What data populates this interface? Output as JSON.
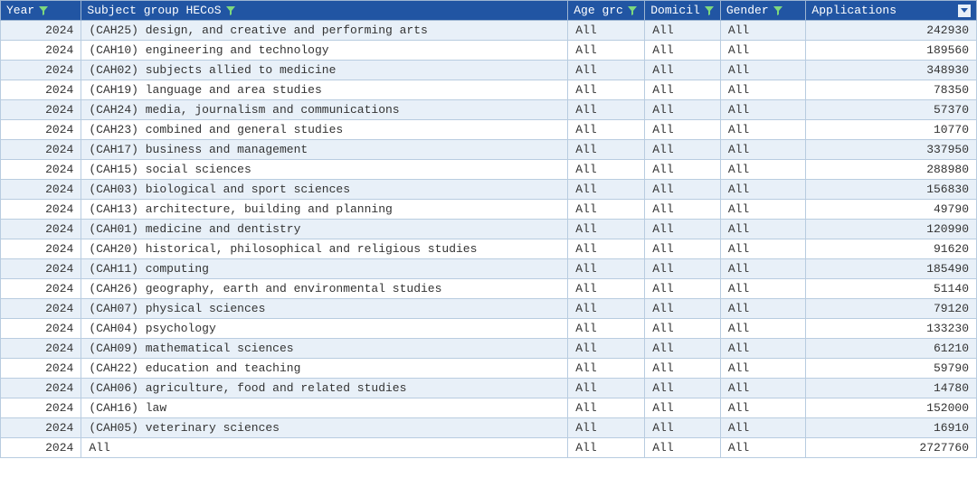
{
  "headers": {
    "year": "Year",
    "subject": "Subject group HECoS",
    "age": "Age grc",
    "domicile": "Domicil",
    "gender": "Gender",
    "applications": "Applications"
  },
  "rows": [
    {
      "year": "2024",
      "subject": "(CAH25) design, and creative and performing arts",
      "age": "All",
      "domicile": "All",
      "gender": "All",
      "applications": "242930"
    },
    {
      "year": "2024",
      "subject": "(CAH10) engineering and technology",
      "age": "All",
      "domicile": "All",
      "gender": "All",
      "applications": "189560"
    },
    {
      "year": "2024",
      "subject": "(CAH02) subjects allied to medicine",
      "age": "All",
      "domicile": "All",
      "gender": "All",
      "applications": "348930"
    },
    {
      "year": "2024",
      "subject": "(CAH19) language and area studies",
      "age": "All",
      "domicile": "All",
      "gender": "All",
      "applications": "78350"
    },
    {
      "year": "2024",
      "subject": "(CAH24) media, journalism and communications",
      "age": "All",
      "domicile": "All",
      "gender": "All",
      "applications": "57370"
    },
    {
      "year": "2024",
      "subject": "(CAH23) combined and general studies",
      "age": "All",
      "domicile": "All",
      "gender": "All",
      "applications": "10770"
    },
    {
      "year": "2024",
      "subject": "(CAH17) business and management",
      "age": "All",
      "domicile": "All",
      "gender": "All",
      "applications": "337950"
    },
    {
      "year": "2024",
      "subject": "(CAH15) social sciences",
      "age": "All",
      "domicile": "All",
      "gender": "All",
      "applications": "288980"
    },
    {
      "year": "2024",
      "subject": "(CAH03) biological and sport sciences",
      "age": "All",
      "domicile": "All",
      "gender": "All",
      "applications": "156830"
    },
    {
      "year": "2024",
      "subject": "(CAH13) architecture, building and planning",
      "age": "All",
      "domicile": "All",
      "gender": "All",
      "applications": "49790"
    },
    {
      "year": "2024",
      "subject": "(CAH01) medicine and dentistry",
      "age": "All",
      "domicile": "All",
      "gender": "All",
      "applications": "120990"
    },
    {
      "year": "2024",
      "subject": "(CAH20) historical, philosophical and religious studies",
      "age": "All",
      "domicile": "All",
      "gender": "All",
      "applications": "91620"
    },
    {
      "year": "2024",
      "subject": "(CAH11) computing",
      "age": "All",
      "domicile": "All",
      "gender": "All",
      "applications": "185490"
    },
    {
      "year": "2024",
      "subject": "(CAH26) geography, earth and environmental studies",
      "age": "All",
      "domicile": "All",
      "gender": "All",
      "applications": "51140"
    },
    {
      "year": "2024",
      "subject": "(CAH07) physical sciences",
      "age": "All",
      "domicile": "All",
      "gender": "All",
      "applications": "79120"
    },
    {
      "year": "2024",
      "subject": "(CAH04) psychology",
      "age": "All",
      "domicile": "All",
      "gender": "All",
      "applications": "133230"
    },
    {
      "year": "2024",
      "subject": "(CAH09) mathematical sciences",
      "age": "All",
      "domicile": "All",
      "gender": "All",
      "applications": "61210"
    },
    {
      "year": "2024",
      "subject": "(CAH22) education and teaching",
      "age": "All",
      "domicile": "All",
      "gender": "All",
      "applications": "59790"
    },
    {
      "year": "2024",
      "subject": "(CAH06) agriculture, food and related studies",
      "age": "All",
      "domicile": "All",
      "gender": "All",
      "applications": "14780"
    },
    {
      "year": "2024",
      "subject": "(CAH16) law",
      "age": "All",
      "domicile": "All",
      "gender": "All",
      "applications": "152000"
    },
    {
      "year": "2024",
      "subject": "(CAH05) veterinary sciences",
      "age": "All",
      "domicile": "All",
      "gender": "All",
      "applications": "16910"
    },
    {
      "year": "2024",
      "subject": "All",
      "age": "All",
      "domicile": "All",
      "gender": "All",
      "applications": "2727760"
    }
  ]
}
